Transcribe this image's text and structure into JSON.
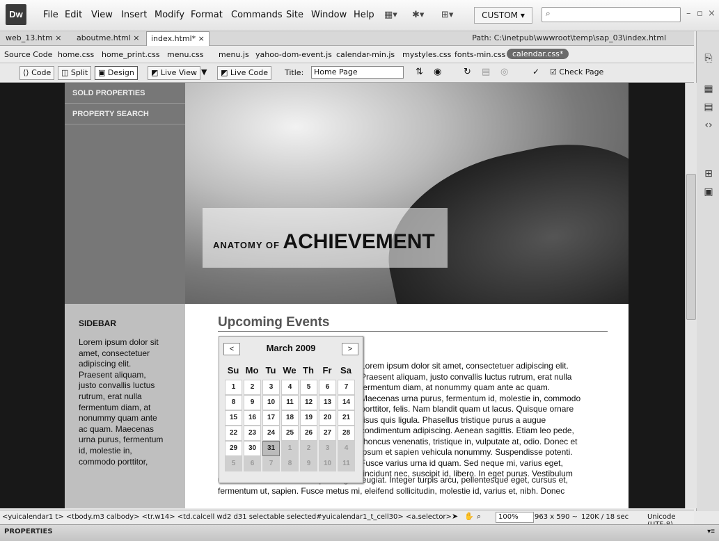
{
  "app": {
    "logo": "Dw"
  },
  "menu": [
    "File",
    "Edit",
    "View",
    "Insert",
    "Modify",
    "Format",
    "Commands",
    "Site",
    "Window",
    "Help"
  ],
  "workspace": {
    "label": "CUSTOM ▾"
  },
  "tabs": [
    {
      "label": "web_13.htm ×"
    },
    {
      "label": "aboutme.html ×"
    },
    {
      "label": "index.html* ×",
      "active": true
    }
  ],
  "path": "Path:  C:\\inetpub\\wwwroot\\temp\\sap_03\\index.html",
  "related_files": [
    "Source Code",
    "home.css",
    "home_print.css",
    "menu.css",
    "menu.js",
    "yahoo-dom-event.js",
    "calendar-min.js",
    "mystyles.css",
    "fonts-min.css",
    "calendar.css*"
  ],
  "doc_toolbar": {
    "code": "Code",
    "split": "Split",
    "design": "Design",
    "live_view": "Live View",
    "live_code": "Live Code",
    "title_label": "Title:",
    "title_value": "Home Page",
    "check_page": "Check Page"
  },
  "page": {
    "nav": [
      "SOLD PROPERTIES",
      "PROPERTY SEARCH"
    ],
    "hero": {
      "small": "ANATOMY OF",
      "big": "ACHIEVEMENT"
    },
    "sidebar": {
      "heading": "SIDEBAR",
      "text": "Lorem ipsum dolor sit amet, consectetuer adipiscing elit. Praesent aliquam, justo convallis luctus rutrum, erat nulla fermentum diam, at nonummy quam ante ac quam. Maecenas urna purus, fermentum id, molestie in, commodo porttitor,"
    },
    "events": {
      "heading": "Upcoming Events",
      "body": "Lorem ipsum dolor sit amet, consectetuer adipiscing elit. Praesent aliquam, justo convallis luctus rutrum, erat nulla fermentum diam, at nonummy quam ante ac quam. Maecenas urna purus, fermentum id, molestie in, commodo porttitor, felis. Nam blandit quam ut lacus. Quisque ornare risus quis ligula. Phasellus tristique purus a augue condimentum adipiscing. Aenean sagittis. Etiam leo pede, rhoncus venenatis, tristique in, vulputate at, odio. Donec et ipsum et sapien vehicula nonummy. Suspendisse potenti. Fusce varius urna id quam. Sed neque mi, varius eget, tincidunt nec, suscipit id, libero. In eget purus. Vestibulum",
      "tail": "ut nisl. Donec eu mi sed turpis feugiat feugiat. Integer turpis arcu, pellentesque eget, cursus et, fermentum ut, sapien. Fusce metus mi, eleifend sollicitudin, molestie id, varius et, nibh. Donec"
    }
  },
  "calendar": {
    "prev": "<",
    "next": ">",
    "title": "March 2009",
    "weekdays": [
      "Su",
      "Mo",
      "Tu",
      "We",
      "Th",
      "Fr",
      "Sa"
    ],
    "weeks": [
      [
        "1",
        "2",
        "3",
        "4",
        "5",
        "6",
        "7"
      ],
      [
        "8",
        "9",
        "10",
        "11",
        "12",
        "13",
        "14"
      ],
      [
        "15",
        "16",
        "17",
        "18",
        "19",
        "20",
        "21"
      ],
      [
        "22",
        "23",
        "24",
        "25",
        "26",
        "27",
        "28"
      ],
      [
        "29",
        "30",
        "31",
        "1",
        "2",
        "3",
        "4"
      ],
      [
        "5",
        "6",
        "7",
        "8",
        "9",
        "10",
        "11"
      ]
    ],
    "selected": "31"
  },
  "status": {
    "tag_selector": "<yuicalendar1 t> <tbody.m3 calbody> <tr.w14> <td.calcell wd2 d31 selectable selected#yuicalendar1_t_cell30> <a.selector>",
    "zoom": "100%",
    "dims": "963 x 590 ~",
    "kb": "120K / 18 sec",
    "encoding": "Unicode (UTF-8)"
  },
  "properties_label": "PROPERTIES"
}
